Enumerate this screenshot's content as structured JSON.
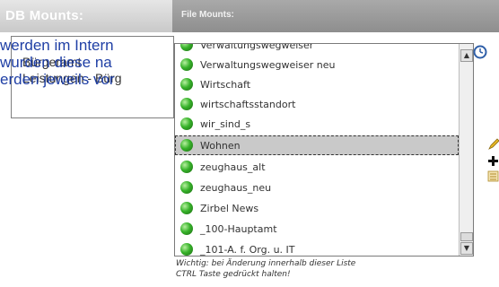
{
  "db_mounts": {
    "title": "DB Mounts:",
    "items": [
      "Bürgeramt",
      "Leistungen - Bürg"
    ]
  },
  "overlay_text": [
    "werden im Intern",
    "wurden diese na",
    "erden jeweils vor"
  ],
  "file_mounts": {
    "title": "File Mounts:",
    "items": [
      {
        "label": "Verwaltungswegweiser"
      },
      {
        "label": "Verwaltungswegweiser neu"
      },
      {
        "label": "Wirtschaft"
      },
      {
        "label": "wirtschaftsstandort"
      },
      {
        "label": "wir_sind_s"
      },
      {
        "label": "Wohnen",
        "selected": true
      },
      {
        "label": "zeughaus_alt"
      },
      {
        "label": "zeughaus_neu"
      },
      {
        "label": "Zirbel News"
      },
      {
        "label": "_100-Hauptamt"
      },
      {
        "label": "_101-A. f. Org. u. IT"
      }
    ],
    "note_line1": "Wichtig: bei Änderung innerhalb dieser Liste",
    "note_line2": "CTRL Taste gedrückt halten!"
  },
  "icons": {
    "clock": "clock-icon",
    "edit": "pencil-icon",
    "add": "plus-icon",
    "list": "list-icon"
  },
  "colors": {
    "overlay_text": "#1f3fa5",
    "globe": "#37b22a",
    "header_dark": "#999999"
  }
}
